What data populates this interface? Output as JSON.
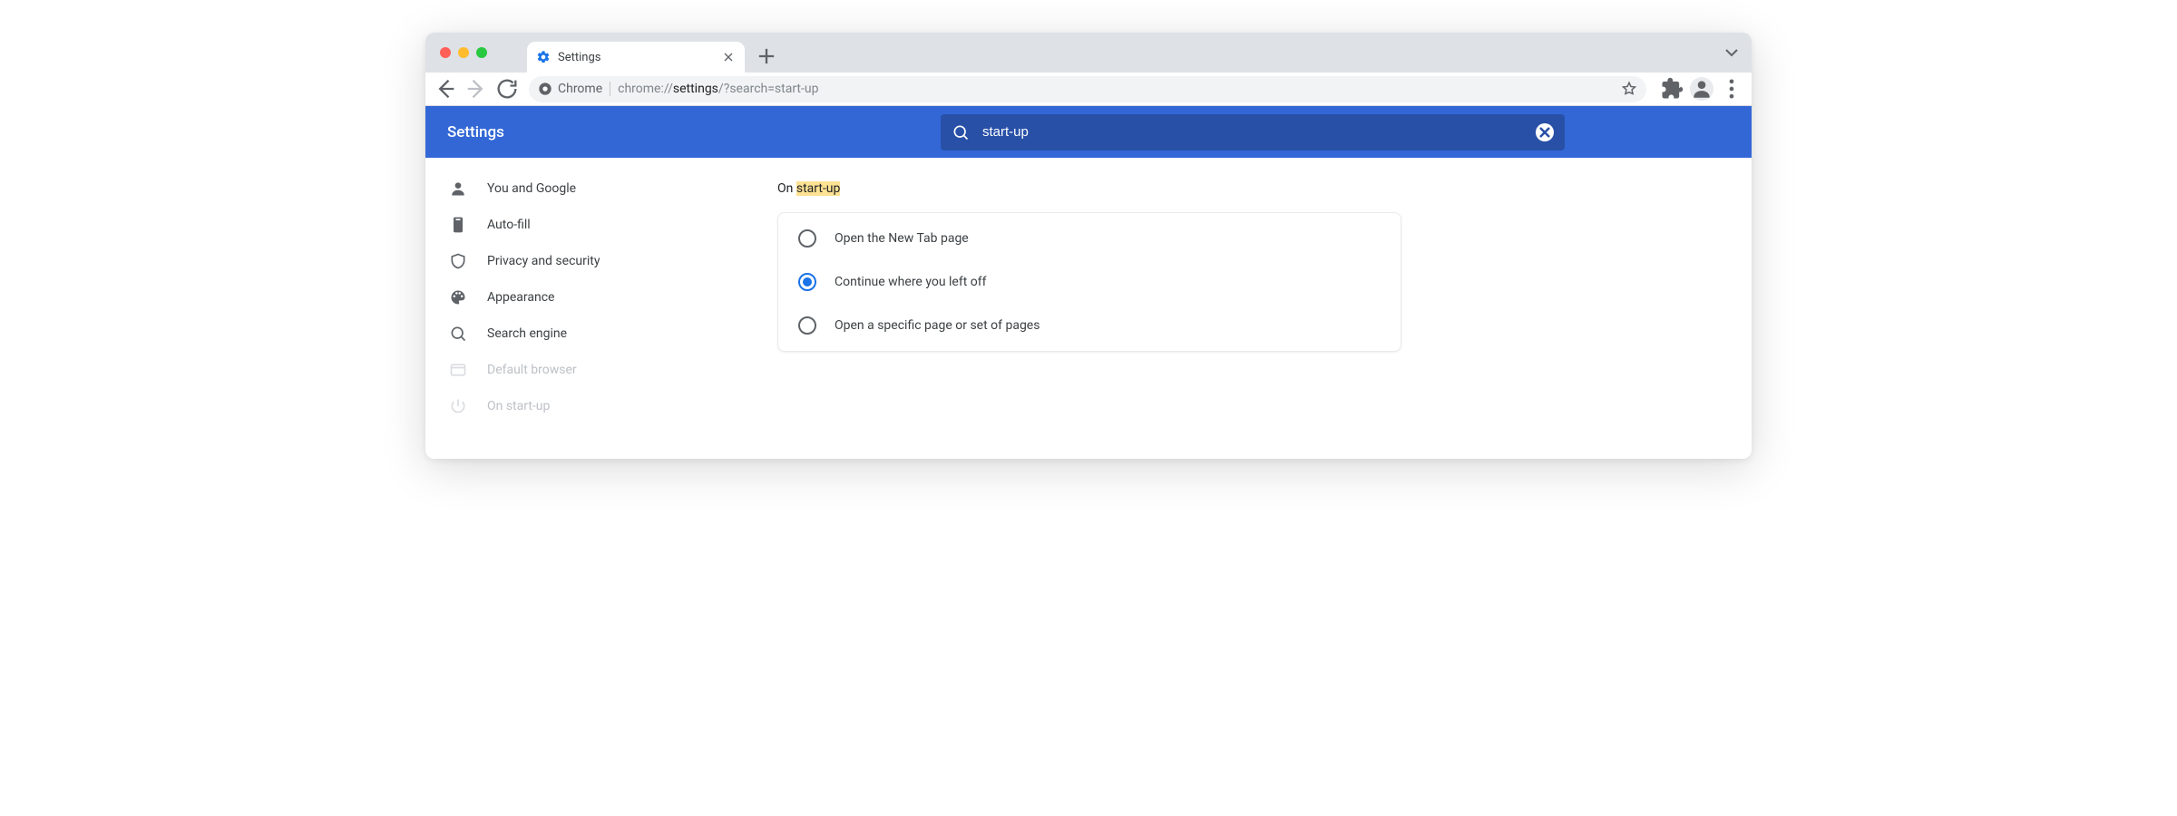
{
  "window": {
    "tab_title": "Settings"
  },
  "omnibox": {
    "chip_label": "Chrome",
    "url_prefix": "chrome://",
    "url_strong": "settings",
    "url_suffix": "/?search=start-up"
  },
  "header": {
    "title": "Settings",
    "search_value": "start-up"
  },
  "sidebar": {
    "items": [
      {
        "label": "You and Google"
      },
      {
        "label": "Auto-fill"
      },
      {
        "label": "Privacy and security"
      },
      {
        "label": "Appearance"
      },
      {
        "label": "Search engine"
      },
      {
        "label": "Default browser"
      },
      {
        "label": "On start-up"
      }
    ]
  },
  "section": {
    "title_prefix": "On ",
    "title_highlight": "start-up",
    "options": [
      {
        "label": "Open the New Tab page",
        "checked": false
      },
      {
        "label": "Continue where you left off",
        "checked": true
      },
      {
        "label": "Open a specific page or set of pages",
        "checked": false
      }
    ]
  }
}
